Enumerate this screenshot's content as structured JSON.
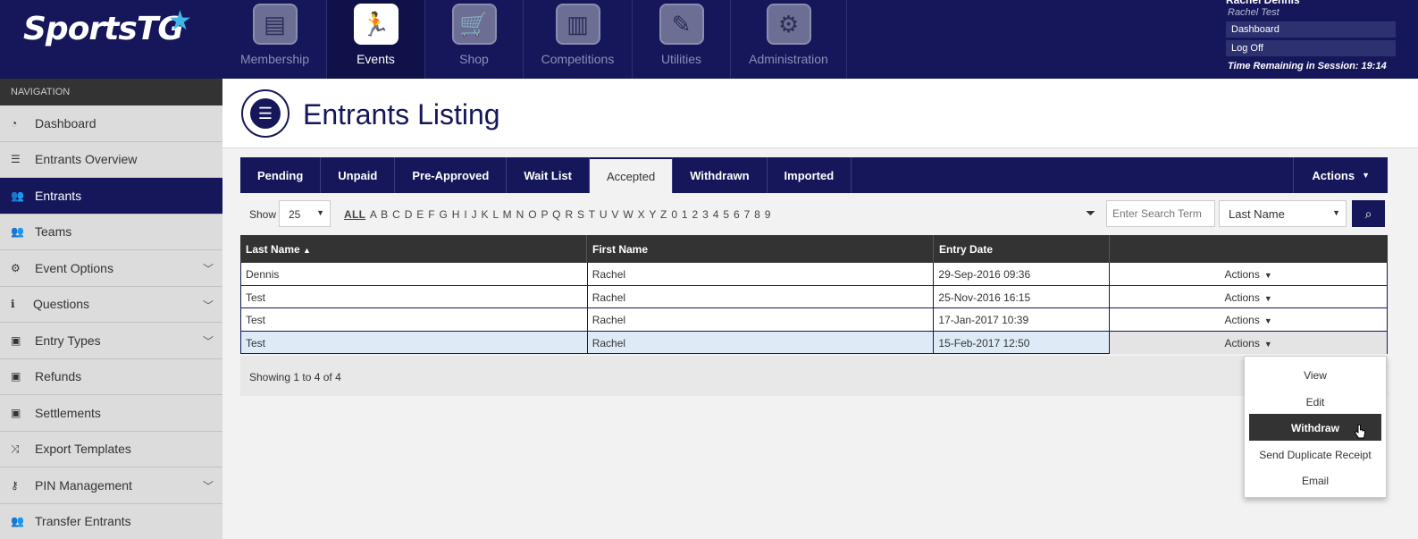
{
  "header": {
    "logo": "SportsTG",
    "nav": [
      {
        "label": "Membership",
        "icon": "membership-icon"
      },
      {
        "label": "Events",
        "icon": "events-runner-icon",
        "active": true
      },
      {
        "label": "Shop",
        "icon": "cart-icon"
      },
      {
        "label": "Competitions",
        "icon": "podium-icon"
      },
      {
        "label": "Utilities",
        "icon": "wrench-icon"
      },
      {
        "label": "Administration",
        "icon": "gear-icon"
      }
    ],
    "user": {
      "name": "Rachel Dennis",
      "subtitle": "Rachel Test",
      "dashboard": "Dashboard",
      "logoff": "Log Off",
      "session": "Time Remaining in Session: 19:14"
    }
  },
  "sidebar": {
    "heading": "NAVIGATION",
    "items": [
      {
        "label": "Dashboard"
      },
      {
        "label": "Entrants Overview"
      },
      {
        "label": "Entrants",
        "active": true
      },
      {
        "label": "Teams"
      },
      {
        "label": "Event Options",
        "expandable": true
      },
      {
        "label": "Questions",
        "expandable": true
      },
      {
        "label": "Entry Types",
        "expandable": true
      },
      {
        "label": "Refunds"
      },
      {
        "label": "Settlements"
      },
      {
        "label": "Export Templates"
      },
      {
        "label": "PIN Management",
        "expandable": true
      },
      {
        "label": "Transfer Entrants"
      }
    ]
  },
  "page": {
    "title": "Entrants Listing"
  },
  "tabs": [
    "Pending",
    "Unpaid",
    "Pre-Approved",
    "Wait List",
    "Accepted",
    "Withdrawn",
    "Imported"
  ],
  "tabs_active": "Accepted",
  "tabs_actions": "Actions",
  "toolbar": {
    "show_label": "Show",
    "page_size": "25",
    "alpha_all": "ALL",
    "alpha_letters": "A B C D E F G H I J K L M N O P Q R S T U V W X Y Z 0 1 2 3 4 5 6 7 8 9",
    "search_placeholder": "Enter Search Term",
    "sort_field": "Last Name"
  },
  "table": {
    "headers": [
      "Last Name",
      "First Name",
      "Entry Date",
      ""
    ],
    "rows": [
      {
        "last": "Dennis",
        "first": "Rachel",
        "date": "29-Sep-2016 09:36",
        "action": "Actions"
      },
      {
        "last": "Test",
        "first": "Rachel",
        "date": "25-Nov-2016 16:15",
        "action": "Actions"
      },
      {
        "last": "Test",
        "first": "Rachel",
        "date": "17-Jan-2017 10:39",
        "action": "Actions"
      },
      {
        "last": "Test",
        "first": "Rachel",
        "date": "15-Feb-2017 12:50",
        "action": "Actions"
      }
    ],
    "showing": "Showing 1 to 4 of 4"
  },
  "dropdown": {
    "items": [
      "View",
      "Edit",
      "Withdraw",
      "Send Duplicate Receipt",
      "Email"
    ],
    "highlighted": "Withdraw"
  },
  "colors": {
    "brand_navy": "#15175a",
    "accent_blue": "#3fb5e8",
    "row_highlight": "#deebf7"
  }
}
